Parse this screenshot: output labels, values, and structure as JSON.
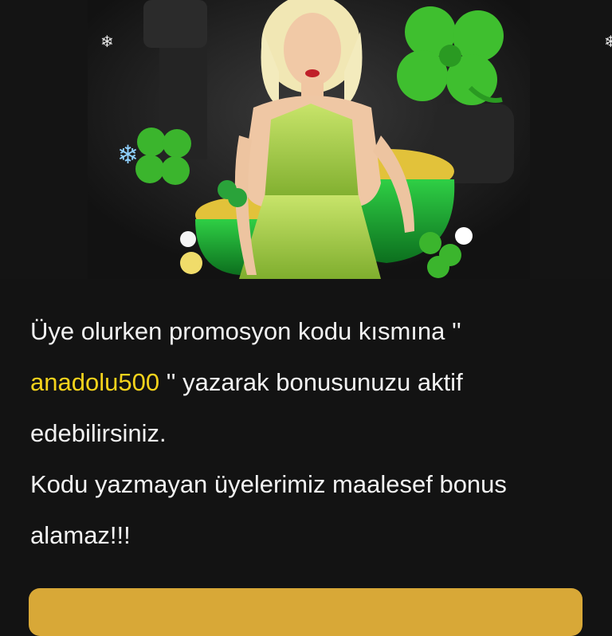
{
  "banner": {
    "image": "promo-woman-clover-pot-of-gold",
    "icons": [
      "snowflake-icon",
      "clover-icon",
      "pot-of-gold"
    ],
    "snowflake_glyph": "❄"
  },
  "promo": {
    "line1": "Üye olurken promosyon kodu kısmına ''",
    "code": "anadolu500",
    "line1_tail": " '' yazarak bonusunuzu aktif edebilirsiniz.",
    "line2": "Kodu yazmayan üyelerimiz maalesef bonus alamaz!!!"
  },
  "colors": {
    "background": "#131313",
    "text": "#f2f2f2",
    "code": "#f5d31c",
    "button": "#d8a837",
    "clover": "#3fbf2f"
  }
}
